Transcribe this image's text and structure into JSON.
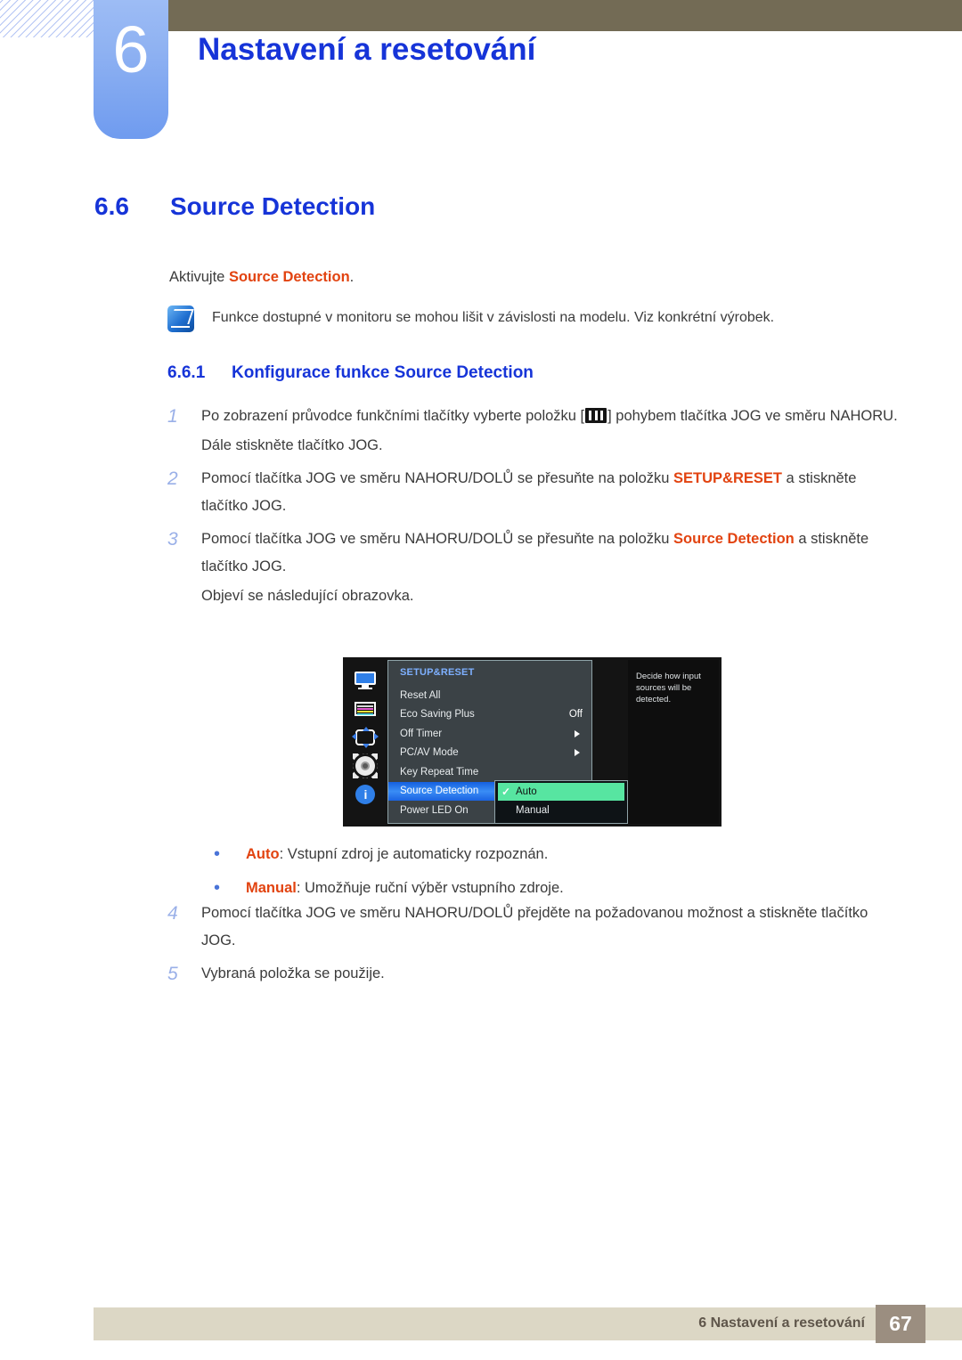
{
  "header": {
    "chapter_number": "6",
    "chapter_title": "Nastavení a resetování"
  },
  "section": {
    "number": "6.6",
    "title": "Source Detection",
    "intro_prefix": "Aktivujte ",
    "intro_highlight": "Source Detection",
    "intro_suffix": ".",
    "note": "Funkce dostupné v monitoru se mohou lišit v závislosti na modelu. Viz konkrétní výrobek.",
    "note_icon": "note-pen-icon"
  },
  "subsection": {
    "number": "6.6.1",
    "title": "Konfigurace funkce Source Detection"
  },
  "steps": [
    {
      "num": "1",
      "part_a": "Po zobrazení průvodce funkčními tlačítky vyberte položku [",
      "icon": "jog-menu-icon",
      "part_b": "] pohybem tlačítka JOG ve směru NAHORU.",
      "extra": "Dále stiskněte tlačítko JOG."
    },
    {
      "num": "2",
      "part_a": "Pomocí tlačítka JOG ve směru NAHORU/DOLŮ se přesuňte na položku ",
      "highlight": "SETUP&RESET",
      "part_b": " a stiskněte tlačítko JOG."
    },
    {
      "num": "3",
      "part_a": "Pomocí tlačítka JOG ve směru NAHORU/DOLŮ se přesuňte na položku ",
      "highlight": "Source Detection",
      "part_b": " a stiskněte tlačítko JOG.",
      "extra": "Objeví se následující obrazovka."
    }
  ],
  "bullets": [
    {
      "marker": "•",
      "term": "Auto",
      "text": ": Vstupní zdroj je automaticky rozpoznán."
    },
    {
      "marker": "•",
      "term": "Manual",
      "text": ": Umožňuje ruční výběr vstupního zdroje."
    }
  ],
  "steps_after": [
    {
      "num": "4",
      "text": "Pomocí tlačítka JOG ve směru NAHORU/DOLŮ přejděte na požadovanou možnost a stiskněte tlačítko JOG."
    },
    {
      "num": "5",
      "text": "Vybraná položka se použije."
    }
  ],
  "osd": {
    "menu_title": "SETUP&RESET",
    "rail_icons": [
      "monitor-icon",
      "color-bars-icon",
      "directional-pad-icon",
      "gear-icon",
      "info-icon"
    ],
    "rows": [
      {
        "label": "Reset All",
        "value": "",
        "arrow": false,
        "selected": false
      },
      {
        "label": "Eco Saving Plus",
        "value": "Off",
        "arrow": false,
        "selected": false
      },
      {
        "label": "Off Timer",
        "value": "",
        "arrow": true,
        "selected": false
      },
      {
        "label": "PC/AV Mode",
        "value": "",
        "arrow": true,
        "selected": false
      },
      {
        "label": "Key Repeat Time",
        "value": "",
        "arrow": false,
        "selected": false
      },
      {
        "label": "Source Detection",
        "value": "",
        "arrow": false,
        "selected": true
      },
      {
        "label": "Power LED On",
        "value": "",
        "arrow": false,
        "selected": false
      }
    ],
    "submenu": [
      {
        "label": "Auto",
        "checked": true
      },
      {
        "label": "Manual",
        "checked": false
      }
    ],
    "tooltip": "Decide how input sources will be detected.",
    "colors": {
      "selected_row": "#2a7af0",
      "submenu_active": "#57e5a1",
      "menu_title": "#7eb0ff",
      "panel_bg": "#3b4246",
      "rail_bg": "#141414"
    }
  },
  "footer": {
    "text": "6 Nastavení a resetování",
    "page": "67"
  },
  "theme": {
    "heading_blue": "#1634d8",
    "highlight_orange": "#e24310",
    "olive": "#736b55",
    "footer_bg": "#dcd7c5",
    "page_badge": "#9b8e80"
  }
}
